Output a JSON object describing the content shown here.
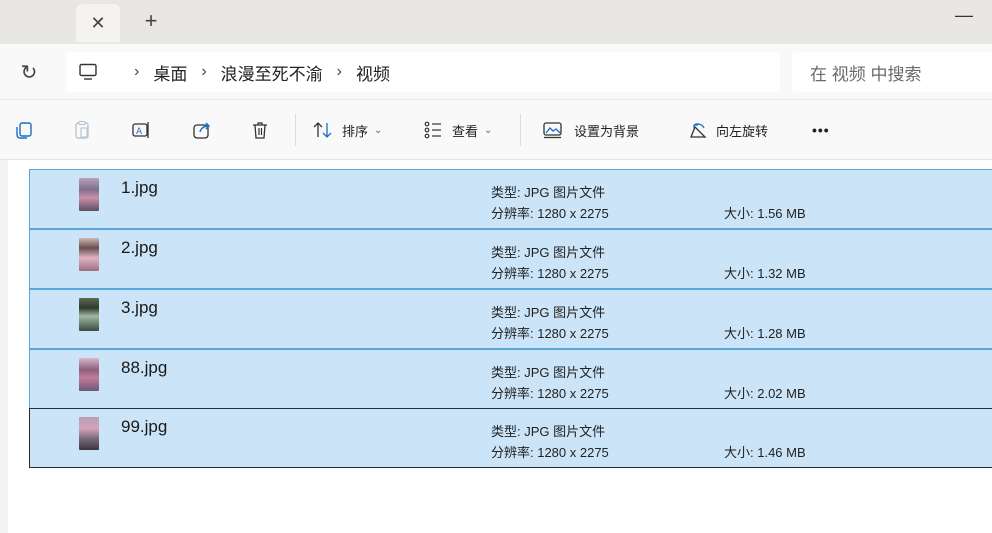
{
  "tabbar": {
    "close_glyph": "✕",
    "new_tab_glyph": "+",
    "minimize_glyph": "—"
  },
  "address": {
    "refresh_glyph": "↻",
    "crumbs": [
      "桌面",
      "浪漫至死不渝",
      "视频"
    ],
    "separator": "›",
    "search_placeholder": "在 视频 中搜索"
  },
  "commands": {
    "sort_label": "排序",
    "view_label": "查看",
    "set_background_label": "设置为背景",
    "rotate_left_label": "向左旋转",
    "more_label": "•••",
    "chevron": "⌄"
  },
  "colors": {
    "selection_bg": "#cce4f7",
    "selection_border": "#5aa6dc",
    "focus_border": "#2b2b2b"
  },
  "files": [
    {
      "name": "1.jpg",
      "type": "类型: JPG 图片文件",
      "resolution": "分辨率: 1280 x 2275",
      "size": "大小: 1.56 MB"
    },
    {
      "name": "2.jpg",
      "type": "类型: JPG 图片文件",
      "resolution": "分辨率: 1280 x 2275",
      "size": "大小: 1.32 MB"
    },
    {
      "name": "3.jpg",
      "type": "类型: JPG 图片文件",
      "resolution": "分辨率: 1280 x 2275",
      "size": "大小: 1.28 MB"
    },
    {
      "name": "88.jpg",
      "type": "类型: JPG 图片文件",
      "resolution": "分辨率: 1280 x 2275",
      "size": "大小: 2.02 MB"
    },
    {
      "name": "99.jpg",
      "type": "类型: JPG 图片文件",
      "resolution": "分辨率: 1280 x 2275",
      "size": "大小: 1.46 MB"
    }
  ]
}
